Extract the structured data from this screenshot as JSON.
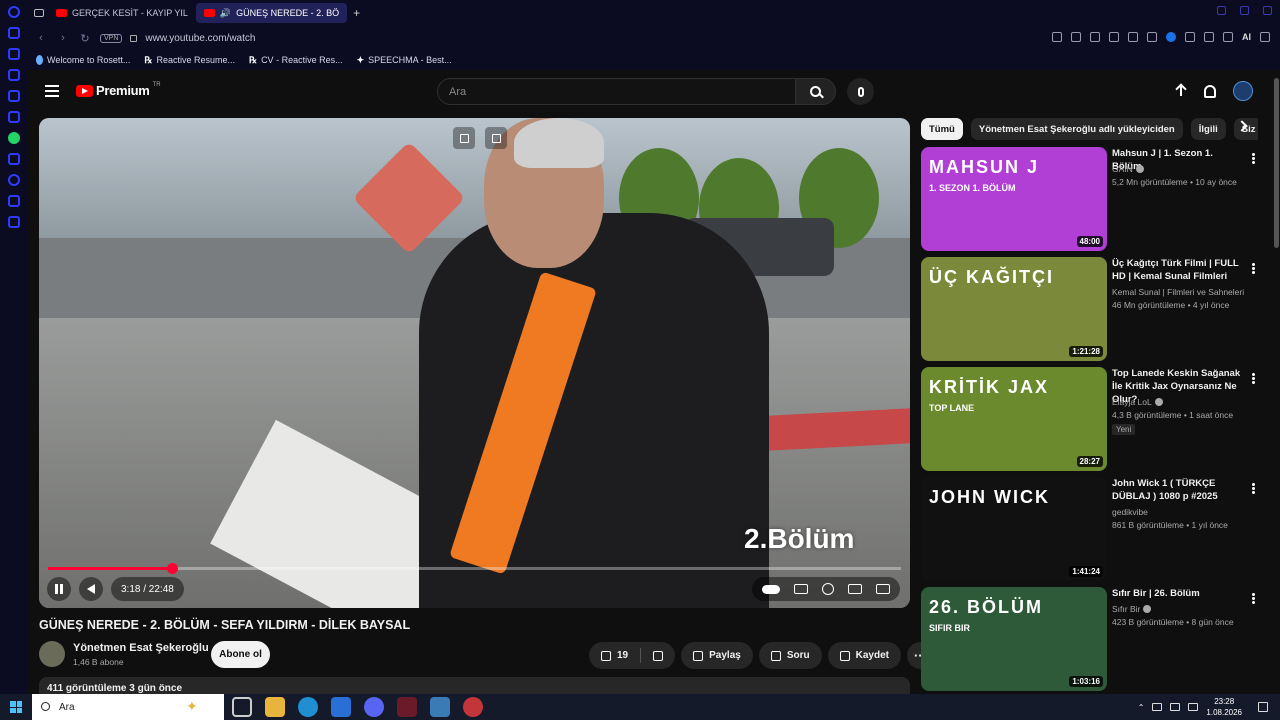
{
  "browser": {
    "tabs": [
      {
        "label": "GERÇEK KESİT - KAYIP YIL",
        "active": false
      },
      {
        "label": "GÜNEŞ NEREDE - 2. BÖ",
        "active": true
      }
    ],
    "new_tab": "+",
    "url": "www.youtube.com/watch",
    "vpn_label": "VPN",
    "ai_label": "AI",
    "bookmarks": [
      {
        "icon": "droplet-icon",
        "label": "Welcome to Rosett..."
      },
      {
        "icon": "rx-icon",
        "label": "Reactive Resume..."
      },
      {
        "icon": "rx-icon",
        "label": "CV - Reactive Res..."
      },
      {
        "icon": "sparkle-icon",
        "label": "SPEECHMA - Best..."
      }
    ]
  },
  "masthead": {
    "logo_text": "Premium",
    "country": "TR",
    "search_placeholder": "Ara"
  },
  "player": {
    "episode_overlay": "2.Bölüm",
    "time": "3:18 / 22:48",
    "progress": 0.145
  },
  "video": {
    "title": "GÜNEŞ NEREDE - 2. BÖLÜM - SEFA YILDIRM - DİLEK BAYSAL",
    "channel": "Yönetmen Esat Şekeroğlu",
    "subscribers": "1,46 B abone",
    "subscribe_label": "Abone ol",
    "likes": "19",
    "share_label": "Paylaş",
    "ask_label": "Soru",
    "save_label": "Kaydet",
    "more_label": "···",
    "views_line": "411 görüntüleme  3 gün önce"
  },
  "chips": [
    "Tümü",
    "Yönetmen Esat Şekeroğlu adlı yükleyiciden",
    "İlgili",
    "Siz"
  ],
  "recommendations": [
    {
      "title": "Mahsun J | 1. Sezon 1. Bölüm",
      "channel": "GAİN",
      "verified": true,
      "meta": "5,2 Mn görüntüleme • 10 ay önce",
      "duration": "48:00",
      "thumb_text": "MAHSUN J",
      "thumb_sub": "1. SEZON 1. BÖLÜM",
      "thumb_color": "#b13fd6"
    },
    {
      "title": "Üç Kağıtçı Türk Filmi | FULL HD | Kemal Sunal Filmleri",
      "channel": "Kemal Sunal | Filmleri ve Sahneleri",
      "verified": false,
      "meta": "46 Mn görüntüleme • 4 yıl önce",
      "duration": "1:21:28",
      "thumb_text": "ÜÇ KAĞITÇI",
      "thumb_sub": "",
      "thumb_color": "#7a8a3a"
    },
    {
      "title": "Top Lanede Keskin Sağanak İle Kritik Jax Oynarsanız Ne Olur?",
      "channel": "Elayja LoL",
      "verified": true,
      "meta": "4,3 B görüntüleme • 1 saat önce",
      "badge": "Yeni",
      "duration": "28:27",
      "thumb_text": "KRİTİK JAX",
      "thumb_sub": "TOP LANE",
      "thumb_color": "#6b8a2e"
    },
    {
      "title": "John Wick 1   ( TÜRKÇE DÜBLAJ ) 1080 p #2025",
      "channel": "gedikvibe",
      "verified": false,
      "meta": "861 B görüntüleme • 1 yıl önce",
      "duration": "1:41:24",
      "thumb_text": "JOHN WICK",
      "thumb_sub": "",
      "thumb_color": "#111111"
    },
    {
      "title": "Sıfır Bir | 26. Bölüm",
      "channel": "Sıfır Bir",
      "verified": true,
      "meta": "423 B görüntüleme • 8 gün önce",
      "duration": "1:03:16",
      "thumb_text": "26. BÖLÜM",
      "thumb_sub": "SIFIR BIR",
      "thumb_color": "#2e5a3a"
    }
  ],
  "taskbar": {
    "search_placeholder": "Ara",
    "time": "23:28",
    "date": "1.08.2026"
  }
}
